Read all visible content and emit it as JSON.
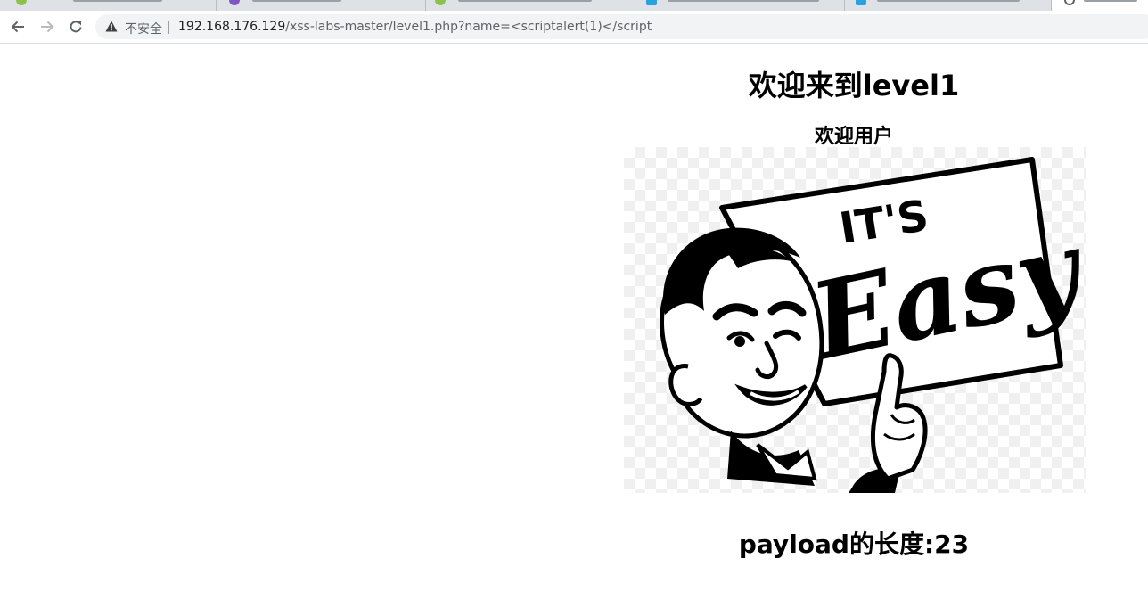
{
  "browser": {
    "security_label": "不安全",
    "url_host": "192.168.176.129",
    "url_path": "/xss-labs-master/level1.php?name=<scriptalert(1)</script"
  },
  "page": {
    "title": "欢迎来到level1",
    "welcome": "欢迎用户",
    "image": {
      "sign_top_text": "IT'S",
      "sign_main_text": "Easy"
    },
    "payload_length": "payload的长度:23"
  },
  "icons": {
    "back": "arrow-left-icon",
    "forward": "arrow-right-icon",
    "reload": "reload-icon",
    "warning": "warning-triangle-icon"
  }
}
